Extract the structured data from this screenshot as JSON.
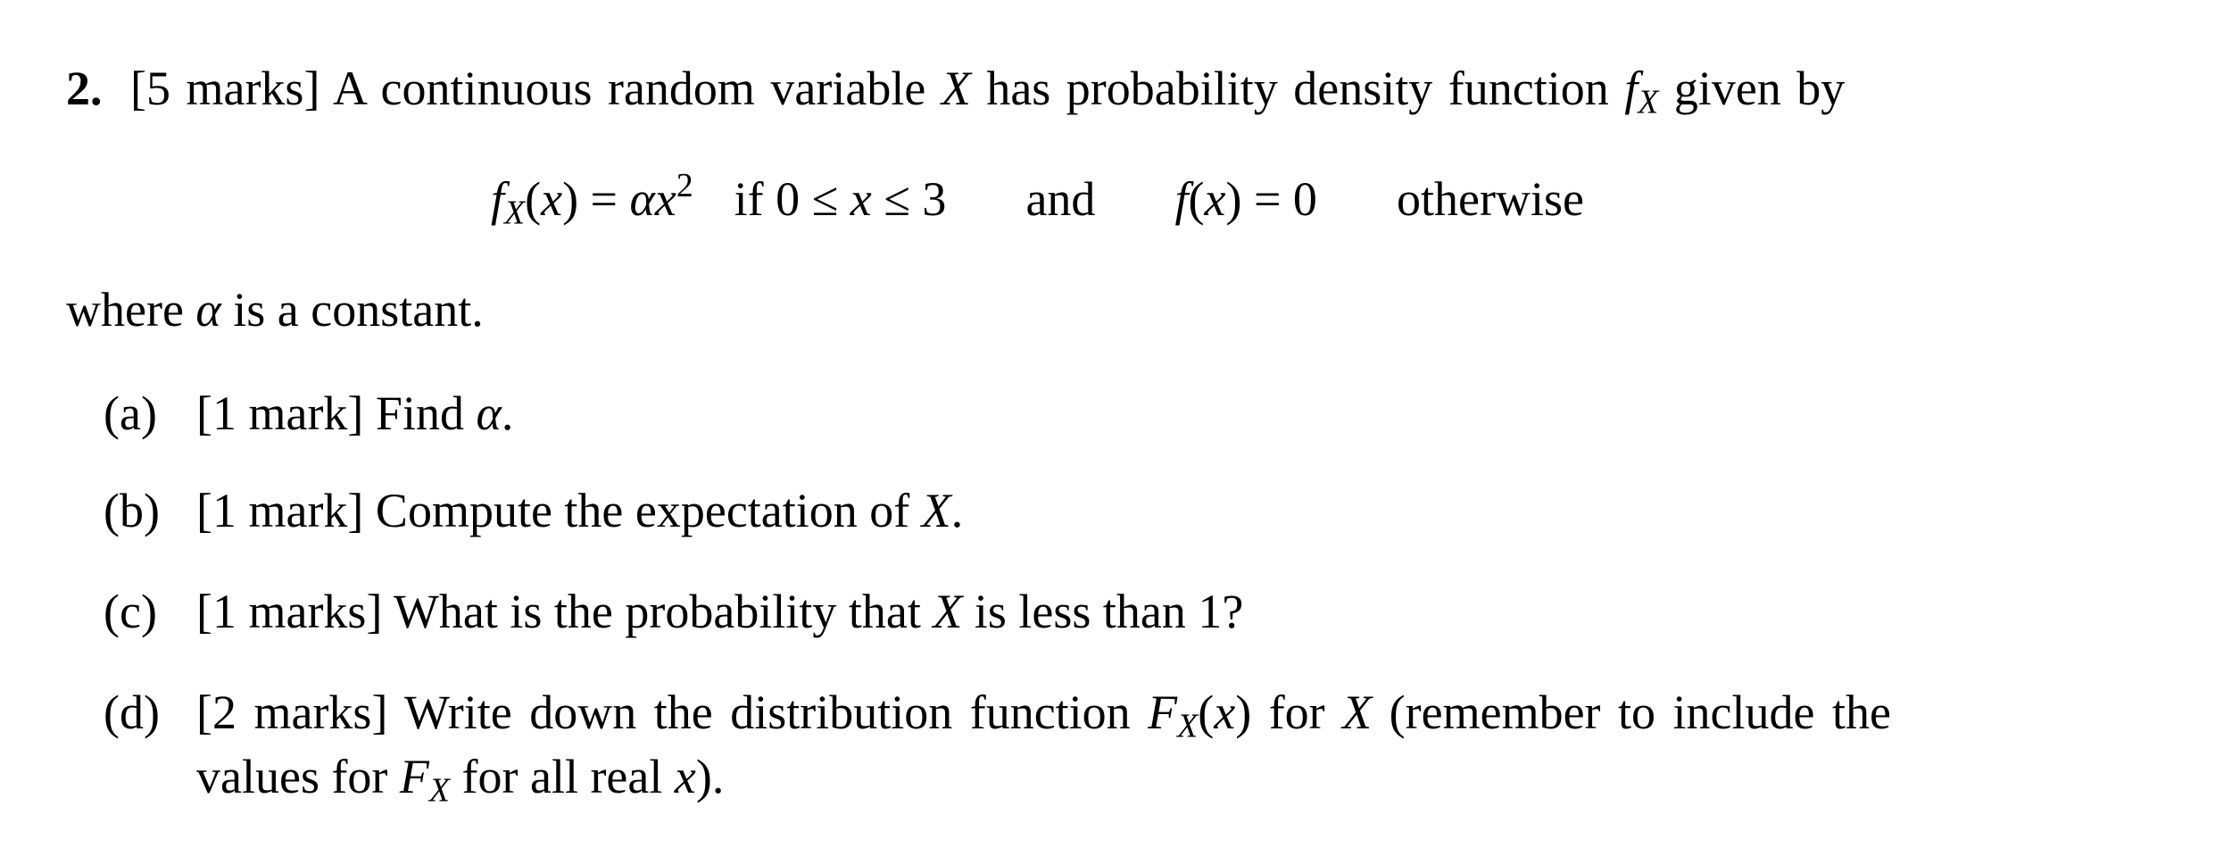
{
  "problem": {
    "number": "2.",
    "marks": "[5 marks]",
    "intro_a": "A continuous random variable",
    "var": "X",
    "intro_b": "has probability density function",
    "f": "f",
    "sub_X": "X",
    "intro_c": "given by"
  },
  "equation": {
    "lhs_f": "f",
    "lhs_sub": "X",
    "lhs_arg": "(x)",
    "eq": " = ",
    "alpha": "αx",
    "exp": "2",
    "cond": "if 0 ≤ ",
    "cond_x": "x",
    "cond_end": " ≤ 3",
    "and": "and",
    "f2": "f",
    "f2_arg": "(x)",
    "f2_eq": " = 0",
    "otherwise": "otherwise"
  },
  "where": {
    "pre": "where",
    "alpha": "α",
    "post": "is a constant."
  },
  "parts": [
    {
      "label": "(a)",
      "marks": "[1 mark]",
      "text": "Find",
      "math": "α",
      "end": "."
    },
    {
      "label": "(b)",
      "marks": "[1 mark]",
      "text": "Compute the expectation of",
      "math": "X",
      "end": "."
    },
    {
      "label": "(c)",
      "marks": "[1 marks]",
      "text": "What is the probability that",
      "math": "X",
      "end": "is less than 1?"
    },
    {
      "label": "(d)",
      "marks": "[2 marks]",
      "text": "Write down the distribution function",
      "math": "F",
      "math_sub": "X",
      "math_arg": "(x)",
      "mid": "for",
      "math2": "X",
      "end": "(remember to include the",
      "cont_pre": "values for",
      "cont_math": "F",
      "cont_sub": "X",
      "cont_mid": "for all real",
      "cont_x": "x",
      "cont_end": ")."
    }
  ]
}
